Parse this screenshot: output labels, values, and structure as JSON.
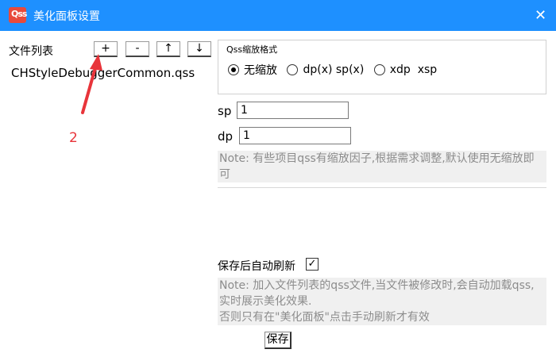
{
  "window": {
    "title": "美化面板设置",
    "icon_text": "Qss",
    "close_symbol": "✕"
  },
  "file_panel": {
    "label": "文件列表",
    "buttons": {
      "add": "+",
      "remove": "-",
      "up": "↑",
      "down": "↓"
    },
    "files": [
      "CHStyleDebuggerCommon.qss"
    ]
  },
  "annotation": {
    "number": "2",
    "color": "#e8343a"
  },
  "qss_format": {
    "group_title": "Qss缩放格式",
    "options": [
      {
        "label": "无缩放",
        "checked": true
      },
      {
        "label": "dp(x) sp(x)",
        "checked": false
      },
      {
        "label": "xdp  xsp",
        "checked": false
      }
    ]
  },
  "fields": {
    "sp_label": "sp",
    "sp_value": "1",
    "dp_label": "dp",
    "dp_value": "1"
  },
  "note_scale": "Note: 有些项目qss有缩放因子,根据需求调整,默认使用无缩放即可",
  "autosave": {
    "label": "保存后自动刷新",
    "checked": true,
    "check_symbol": "✓"
  },
  "note_refresh": "Note: 加入文件列表的qss文件,当文件被修改时,会自动加载qss,实时展示美化效果.\n否则只有在\"美化面板\"点击手动刷新才有效",
  "save_label": "保存",
  "colors": {
    "titlebar": "#1e90ff",
    "note_bg": "#f0f0f0",
    "note_text": "#8c8c8c"
  }
}
